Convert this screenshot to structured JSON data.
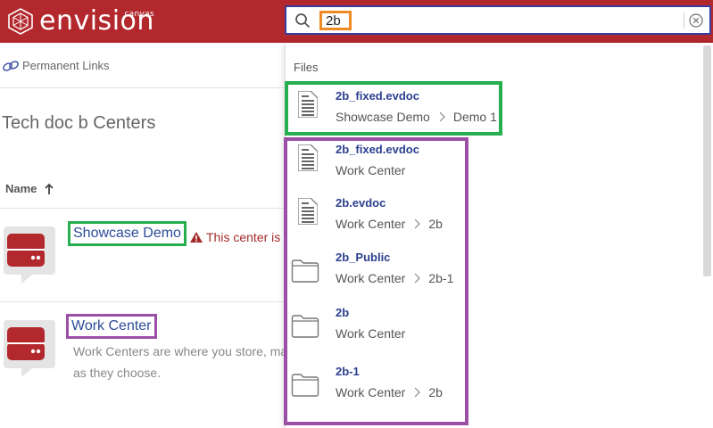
{
  "app": {
    "brand": "envision",
    "brand_sub": "canvas",
    "accent": "#b3282d"
  },
  "search": {
    "value": "2b",
    "placeholder": ""
  },
  "left": {
    "permanent_links": "Permanent Links",
    "page_title": "Tech doc b Centers",
    "column_header": "Name",
    "centers": [
      {
        "name": "Showcase Demo",
        "warning": "This center is p"
      },
      {
        "name": "Work Center",
        "description_line1": "Work Centers are where you store, ma",
        "description_line2": "as they choose."
      }
    ]
  },
  "dropdown": {
    "heading": "Files",
    "results": [
      {
        "type": "doc",
        "title": "2b_fixed.evdoc",
        "path": [
          "Showcase Demo",
          "Demo 1"
        ]
      },
      {
        "type": "doc",
        "title": "2b_fixed.evdoc",
        "path": [
          "Work Center"
        ]
      },
      {
        "type": "doc",
        "title": "2b.evdoc",
        "path": [
          "Work Center",
          "2b"
        ]
      },
      {
        "type": "folder",
        "title": "2b_Public",
        "path": [
          "Work Center",
          "2b-1"
        ]
      },
      {
        "type": "folder",
        "title": "2b",
        "path": [
          "Work Center"
        ]
      },
      {
        "type": "folder",
        "title": "2b-1",
        "path": [
          "Work Center",
          "2b"
        ]
      }
    ]
  },
  "icons": {
    "logo": "envision-logo-icon",
    "search": "search-icon",
    "clear": "clear-circle-x-icon",
    "link": "link-icon",
    "sort": "arrow-up-icon",
    "warning": "warning-triangle-icon",
    "center": "center-server-icon",
    "doc": "document-icon",
    "folder": "folder-icon",
    "breadcrumb": "chevron-right-icon"
  },
  "highlight_colors": {
    "green": "#27ae4f",
    "purple": "#9b4fa5",
    "orange": "#f08a24"
  }
}
